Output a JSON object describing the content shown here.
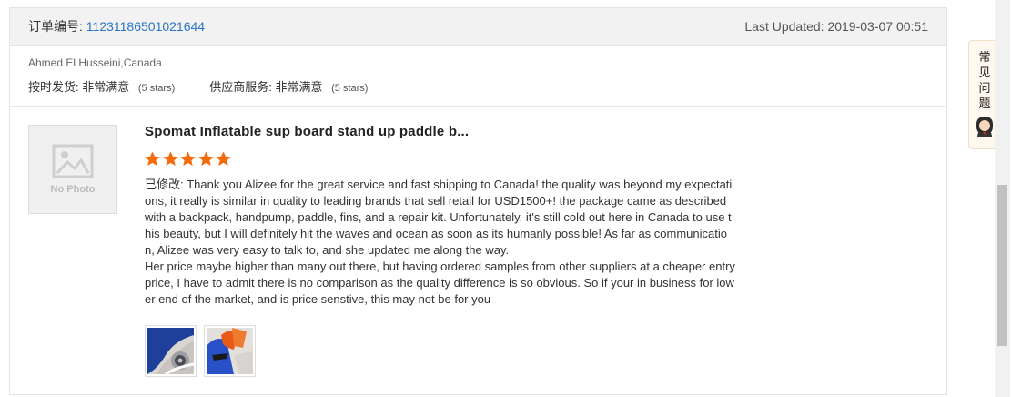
{
  "order": {
    "label": "订单编号:",
    "number": "11231186501021644",
    "last_updated_label": "Last Updated:",
    "last_updated_value": "2019-03-07 00:51"
  },
  "buyer": {
    "name": "Ahmed El Husseini,Canada",
    "ratings": [
      {
        "label": "按时发货:",
        "value": "非常满意",
        "stars_text": "(5 stars)"
      },
      {
        "label": "供应商服务:",
        "value": "非常满意",
        "stars_text": "(5 stars)"
      }
    ]
  },
  "product": {
    "no_photo_text": "No Photo",
    "title": "Spomat Inflatable sup board stand up paddle b...",
    "rating": 5,
    "star_color": "#f66c0a"
  },
  "review": {
    "prefix": "已修改:",
    "body": " Thank you Alizee for the great service and fast shipping to Canada! the quality was beyond my expectations, it really is similar in quality to leading brands that sell retail for USD1500+! the package came as described with a backpack, handpump, paddle, fins, and a repair kit. Unfortunately, it's still cold out here in Canada to use this beauty, but I will definitely hit the waves and ocean as soon as its humanly possible! As far as communication, Alizee was very easy to talk to, and she updated me along the way.\nHer price maybe higher than many out there, but having ordered samples from other suppliers at a cheaper entry price, I have to admit there is no comparison as the quality difference is so obvious. So if your in business for lower end of the market, and is price senstive, this may not be for you"
  },
  "help": {
    "chars": [
      "常",
      "见",
      "问",
      "题"
    ],
    "icon": "customer-service-avatar-icon"
  },
  "colors": {
    "link": "#2a74c6",
    "header_bg": "#f2f2f2",
    "star": "#f66c0a"
  }
}
